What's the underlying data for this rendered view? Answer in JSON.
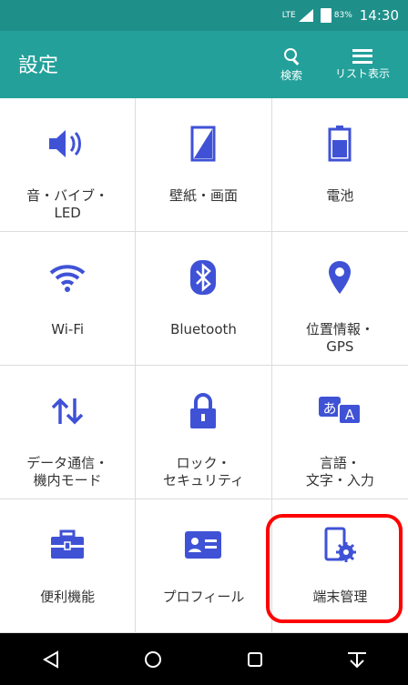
{
  "status_bar": {
    "lte_label": "LTE",
    "battery_percent": "83%",
    "time": "14:30"
  },
  "app_bar": {
    "title": "設定",
    "search_label": "検索",
    "list_label": "リスト表示"
  },
  "tiles": [
    {
      "label": "音・バイブ・\nLED",
      "icon": "speaker-icon"
    },
    {
      "label": "壁紙・画面",
      "icon": "wallpaper-icon"
    },
    {
      "label": "電池",
      "icon": "battery-icon"
    },
    {
      "label": "Wi-Fi",
      "icon": "wifi-icon"
    },
    {
      "label": "Bluetooth",
      "icon": "bluetooth-icon"
    },
    {
      "label": "位置情報・\nGPS",
      "icon": "location-icon"
    },
    {
      "label": "データ通信・\n機内モード",
      "icon": "data-transfer-icon"
    },
    {
      "label": "ロック・\nセキュリティ",
      "icon": "lock-icon"
    },
    {
      "label": "言語・\n文字・入力",
      "icon": "language-icon"
    },
    {
      "label": "便利機能",
      "icon": "toolbox-icon"
    },
    {
      "label": "プロフィール",
      "icon": "profile-card-icon"
    },
    {
      "label": "端末管理",
      "icon": "device-settings-icon"
    }
  ],
  "colors": {
    "accent": "#23a09a",
    "status_bar": "#1f8f8a",
    "icon_blue": "#3f52d6",
    "highlight": "#ff0000"
  }
}
